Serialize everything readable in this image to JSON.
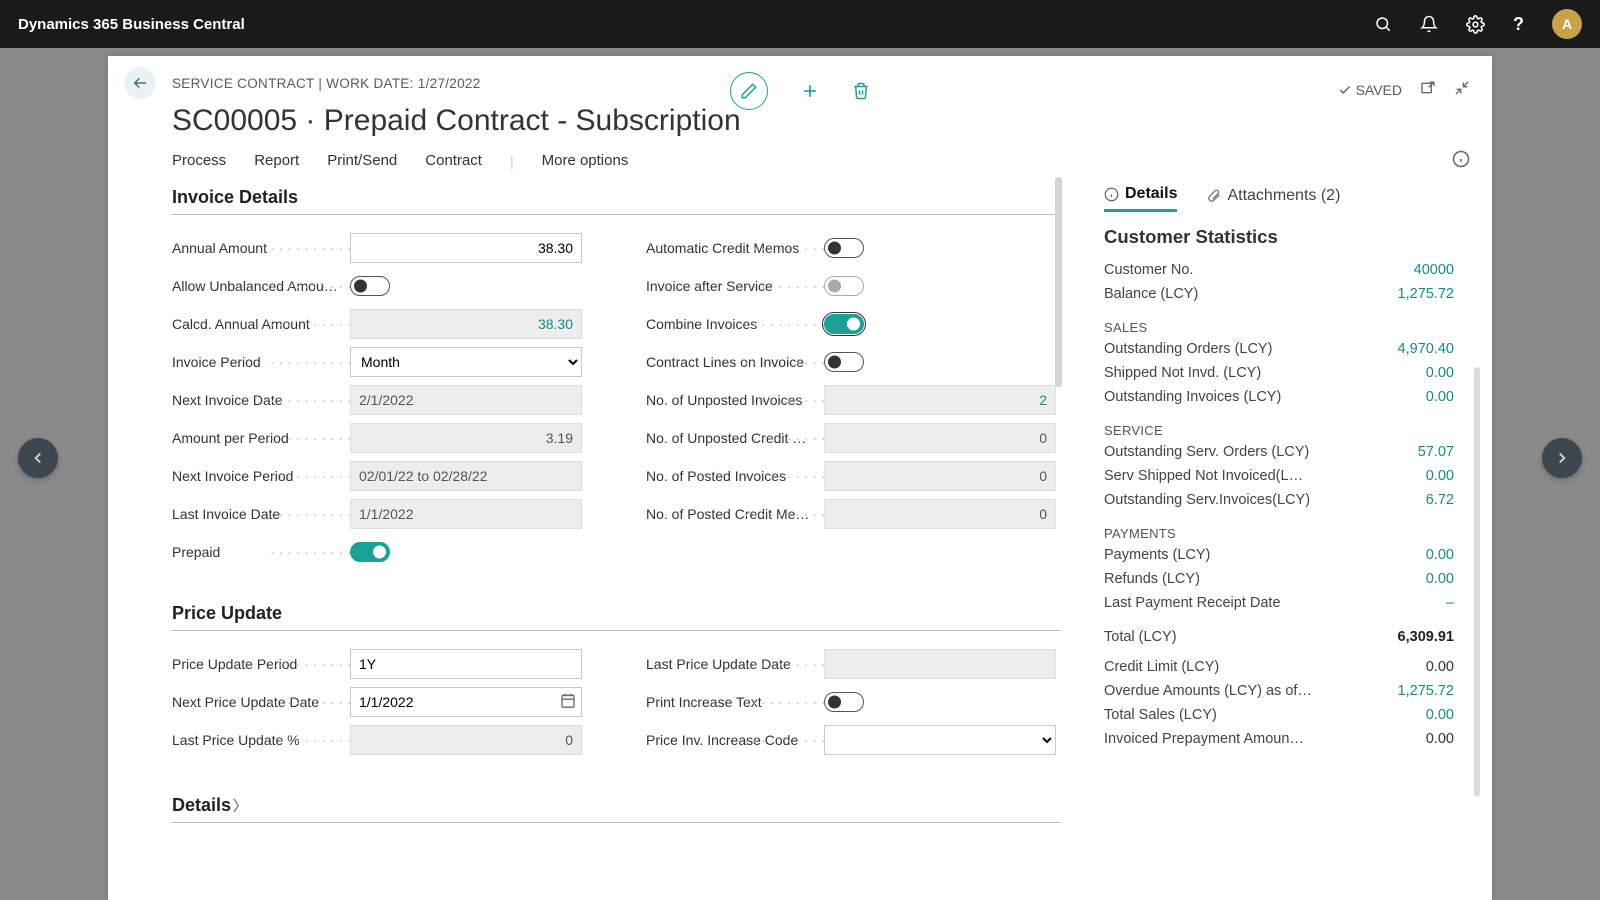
{
  "titlebar": {
    "brand": "Dynamics 365 Business Central",
    "avatar_initial": "A"
  },
  "header": {
    "breadcrumb": "SERVICE CONTRACT | WORK DATE: 1/27/2022",
    "title": "SC00005 · Prepaid Contract - Subscription",
    "saved": "SAVED"
  },
  "action_tabs": {
    "process": "Process",
    "report": "Report",
    "print_send": "Print/Send",
    "contract": "Contract",
    "more": "More options"
  },
  "sections": {
    "invoice_details": "Invoice Details",
    "price_update": "Price Update",
    "details": "Details"
  },
  "invoice": {
    "annual_amount_label": "Annual Amount",
    "annual_amount": "38.30",
    "allow_unbalanced_label": "Allow Unbalanced Amou…",
    "calc_annual_amount_label": "Calcd. Annual Amount",
    "calc_annual_amount": "38.30",
    "invoice_period_label": "Invoice Period",
    "invoice_period": "Month",
    "next_invoice_date_label": "Next Invoice Date",
    "next_invoice_date": "2/1/2022",
    "amount_per_period_label": "Amount per Period",
    "amount_per_period": "3.19",
    "next_invoice_period_label": "Next Invoice Period",
    "next_invoice_period": "02/01/22 to 02/28/22",
    "last_invoice_date_label": "Last Invoice Date",
    "last_invoice_date": "1/1/2022",
    "prepaid_label": "Prepaid",
    "auto_credit_memos_label": "Automatic Credit Memos",
    "invoice_after_service_label": "Invoice after Service",
    "combine_invoices_label": "Combine Invoices",
    "contract_lines_on_invoice_label": "Contract Lines on Invoice",
    "unposted_invoices_label": "No. of Unposted Invoices",
    "unposted_invoices": "2",
    "unposted_credit_label": "No. of Unposted Credit …",
    "unposted_credit": "0",
    "posted_invoices_label": "No. of Posted Invoices",
    "posted_invoices": "0",
    "posted_credit_label": "No. of Posted Credit Me…",
    "posted_credit": "0"
  },
  "price": {
    "update_period_label": "Price Update Period",
    "update_period": "1Y",
    "next_update_date_label": "Next Price Update Date",
    "next_update_date": "1/1/2022",
    "last_update_pct_label": "Last Price Update %",
    "last_update_pct": "0",
    "last_update_date_label": "Last Price Update Date",
    "last_update_date": "",
    "print_increase_text_label": "Print Increase Text",
    "price_inv_increase_code_label": "Price Inv. Increase Code"
  },
  "factbox": {
    "details_tab": "Details",
    "attachments_tab": "Attachments (2)",
    "customer_stats_title": "Customer Statistics",
    "customer_no_label": "Customer No.",
    "customer_no": "40000",
    "balance_label": "Balance (LCY)",
    "balance": "1,275.72",
    "sales_head": "SALES",
    "outstanding_orders_label": "Outstanding Orders (LCY)",
    "outstanding_orders": "4,970.40",
    "shipped_not_invd_label": "Shipped Not Invd. (LCY)",
    "shipped_not_invd": "0.00",
    "outstanding_invoices_label": "Outstanding Invoices (LCY)",
    "outstanding_invoices": "0.00",
    "service_head": "SERVICE",
    "out_serv_orders_label": "Outstanding Serv. Orders (LCY)",
    "out_serv_orders": "57.07",
    "serv_shipped_label": "Serv Shipped Not Invoiced(L…",
    "serv_shipped": "0.00",
    "out_serv_invoices_label": "Outstanding Serv.Invoices(LCY)",
    "out_serv_invoices": "6.72",
    "payments_head": "PAYMENTS",
    "payments_label": "Payments (LCY)",
    "payments": "0.00",
    "refunds_label": "Refunds (LCY)",
    "refunds": "0.00",
    "last_receipt_label": "Last Payment Receipt Date",
    "last_receipt": "–",
    "total_label": "Total (LCY)",
    "total": "6,309.91",
    "credit_limit_label": "Credit Limit (LCY)",
    "credit_limit": "0.00",
    "overdue_label": "Overdue Amounts (LCY) as of…",
    "overdue": "1,275.72",
    "total_sales_label": "Total Sales (LCY)",
    "total_sales": "0.00",
    "invoiced_prepay_label": "Invoiced Prepayment Amoun…",
    "invoiced_prepay": "0.00"
  }
}
